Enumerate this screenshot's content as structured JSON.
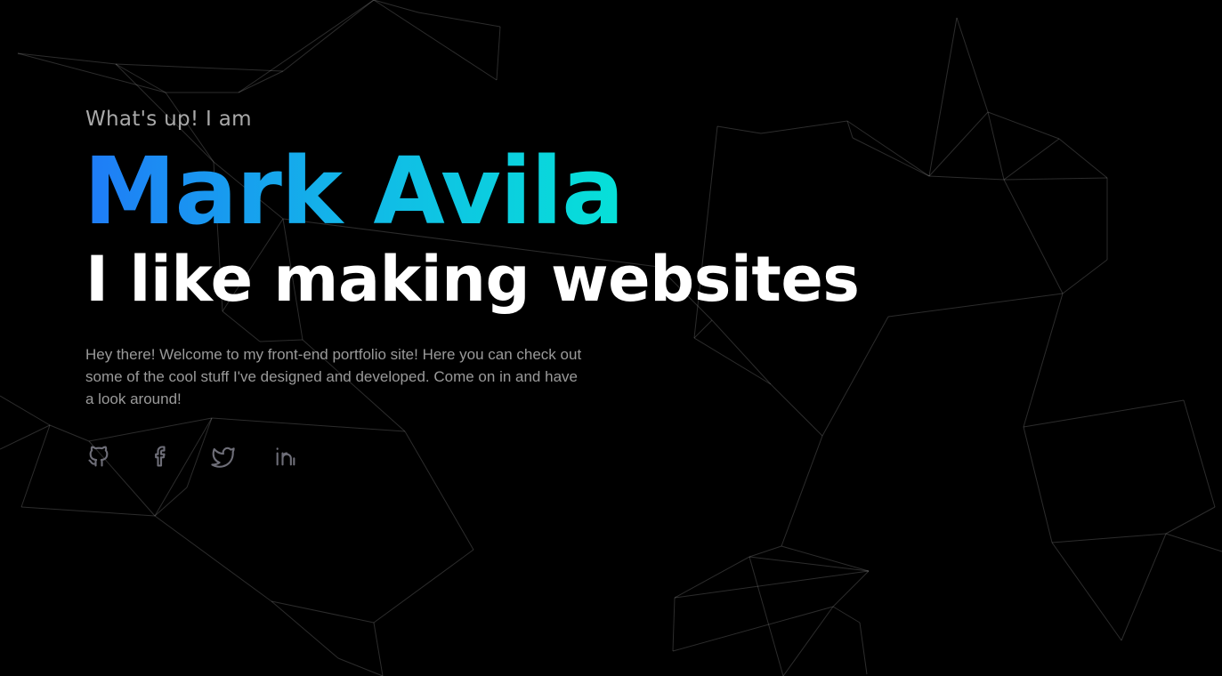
{
  "hero": {
    "greeting": "What's up! I am",
    "name": "Mark Avila",
    "tagline": "I like making websites",
    "intro": "Hey there! Welcome to my front-end portfolio site! Here you can check out some of the cool stuff I've designed and developed. Come on in and have a look around!"
  },
  "colors": {
    "background": "#000000",
    "name_gradient_start": "#1f7bf7",
    "name_gradient_end": "#06e1d8",
    "tagline": "#ffffff",
    "muted_text": "#9a9a9a",
    "icon": "#6e6e78"
  },
  "socials": [
    {
      "icon": "github-icon"
    },
    {
      "icon": "facebook-icon"
    },
    {
      "icon": "twitter-icon"
    },
    {
      "icon": "linkedin-icon"
    }
  ]
}
